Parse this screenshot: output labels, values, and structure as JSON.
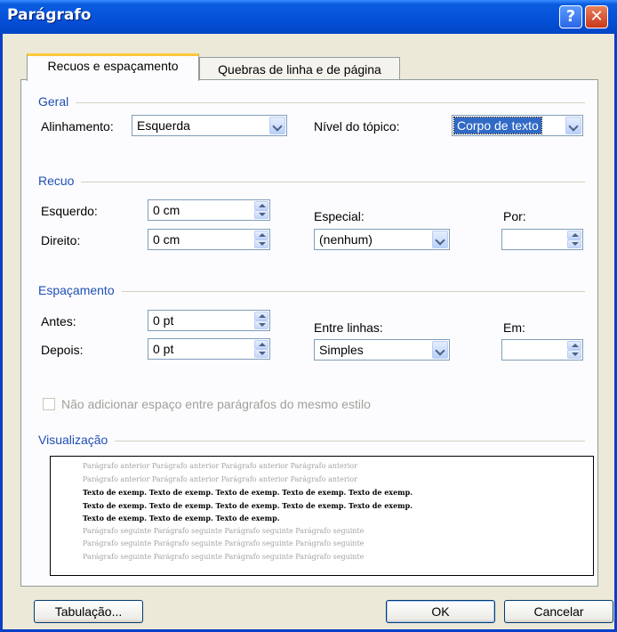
{
  "window": {
    "title": "Parágrafo",
    "help_label": "?",
    "close_label": "✕"
  },
  "tabs": [
    {
      "label": "Recuos e espaçamento"
    },
    {
      "label": "Quebras de linha e de página"
    }
  ],
  "geral": {
    "section_label": "Geral",
    "alinhamento_label": "Alinhamento:",
    "alinhamento_value": "Esquerda",
    "nivel_label": "Nível do tópico:",
    "nivel_value": "Corpo de texto"
  },
  "recuo": {
    "section_label": "Recuo",
    "esquerdo_label": "Esquerdo:",
    "esquerdo_value": "0 cm",
    "direito_label": "Direito:",
    "direito_value": "0 cm",
    "especial_label": "Especial:",
    "especial_value": "(nenhum)",
    "por_label": "Por:",
    "por_value": ""
  },
  "espacamento": {
    "section_label": "Espaçamento",
    "antes_label": "Antes:",
    "antes_value": "0 pt",
    "depois_label": "Depois:",
    "depois_value": "0 pt",
    "entre_label": "Entre linhas:",
    "entre_value": "Simples",
    "em_label": "Em:",
    "em_value": "",
    "checkbox_label": "Não adicionar espaço entre parágrafos do mesmo estilo"
  },
  "visualizacao": {
    "section_label": "Visualização",
    "lines": [
      "Parágrafo anterior Parágrafo anterior Parágrafo anterior Parágrafo anterior",
      "Parágrafo anterior Parágrafo anterior Parágrafo anterior Parágrafo anterior",
      "Texto de exemp. Texto de exemp. Texto de exemp. Texto de exemp. Texto de exemp.",
      "Texto de exemp. Texto de exemp. Texto de exemp. Texto de exemp. Texto de exemp.",
      "Texto de exemp. Texto de exemp. Texto de exemp.",
      "Parágrafo seguinte Parágrafo seguinte Parágrafo seguinte Parágrafo seguinte",
      "Parágrafo seguinte Parágrafo seguinte Parágrafo seguinte Parágrafo seguinte",
      "Parágrafo seguinte Parágrafo seguinte Parágrafo seguinte Parágrafo seguinte"
    ]
  },
  "buttons": {
    "tabulacao": "Tabulação...",
    "ok": "OK",
    "cancelar": "Cancelar"
  }
}
